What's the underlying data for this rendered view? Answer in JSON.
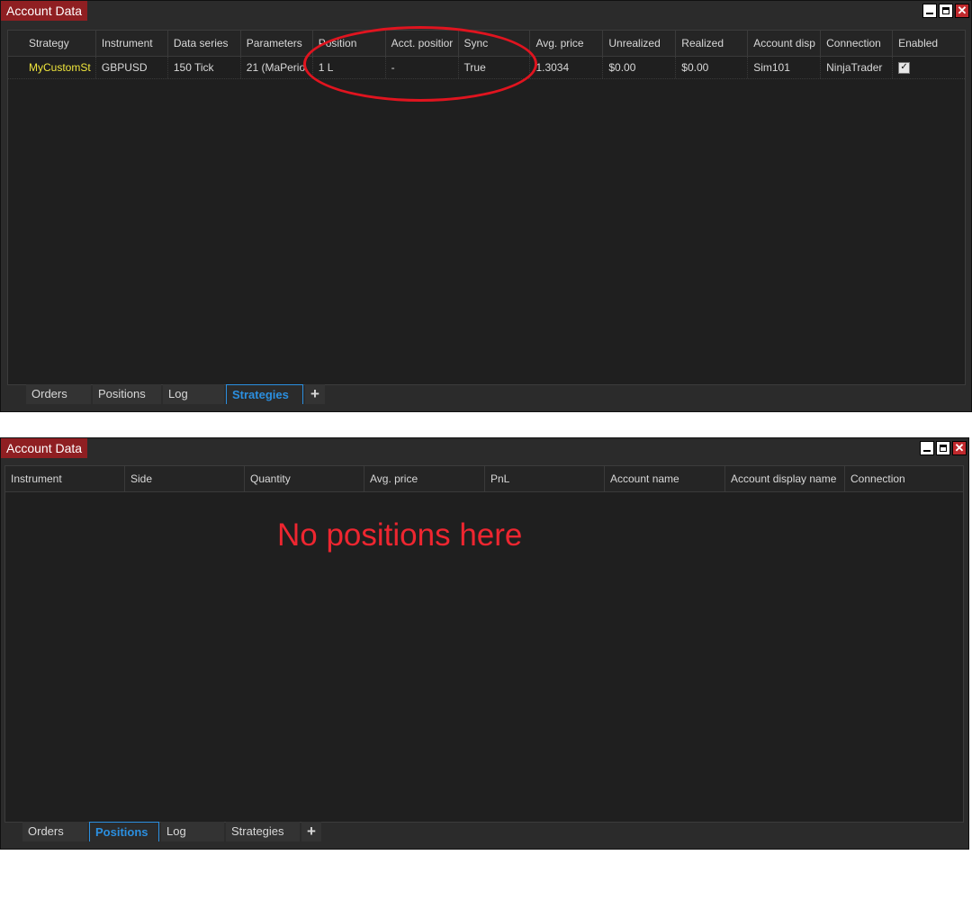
{
  "top_window": {
    "title": "Account Data",
    "columns": [
      "Strategy",
      "Instrument",
      "Data series",
      "Parameters",
      "Position",
      "Acct. positior",
      "Sync",
      "Avg. price",
      "Unrealized",
      "Realized",
      "Account disp",
      "Connection",
      "Enabled"
    ],
    "row": {
      "strategy": "MyCustomSt",
      "instrument": "GBPUSD",
      "data_series": "150 Tick",
      "parameters": "21 (MaPerio",
      "position": "1 L",
      "acct_position": "-",
      "sync": "True",
      "avg_price": "1.3034",
      "unrealized": "$0.00",
      "realized": "$0.00",
      "account_display": "Sim101",
      "connection": "NinjaTrader",
      "enabled": true
    },
    "tabs": [
      "Orders",
      "Positions",
      "Log",
      "Strategies"
    ],
    "active_tab": "Strategies",
    "add_tab_label": "+"
  },
  "bottom_window": {
    "title": "Account Data",
    "columns": [
      "Instrument",
      "Side",
      "Quantity",
      "Avg. price",
      "PnL",
      "Account name",
      "Account display name",
      "Connection"
    ],
    "annotation": "No positions here",
    "tabs": [
      "Orders",
      "Positions",
      "Log",
      "Strategies"
    ],
    "active_tab": "Positions",
    "add_tab_label": "+"
  },
  "colors": {
    "title_bg": "#8f1f22",
    "strategy_text": "#f0e63c",
    "active_tab": "#2b8fe0",
    "annotation": "#e0141f"
  },
  "icons": {
    "minimize": "minimize-icon",
    "maximize": "maximize-icon",
    "close": "close-icon",
    "enabled": "checkbox-checked-icon",
    "add_tab": "plus-icon"
  }
}
